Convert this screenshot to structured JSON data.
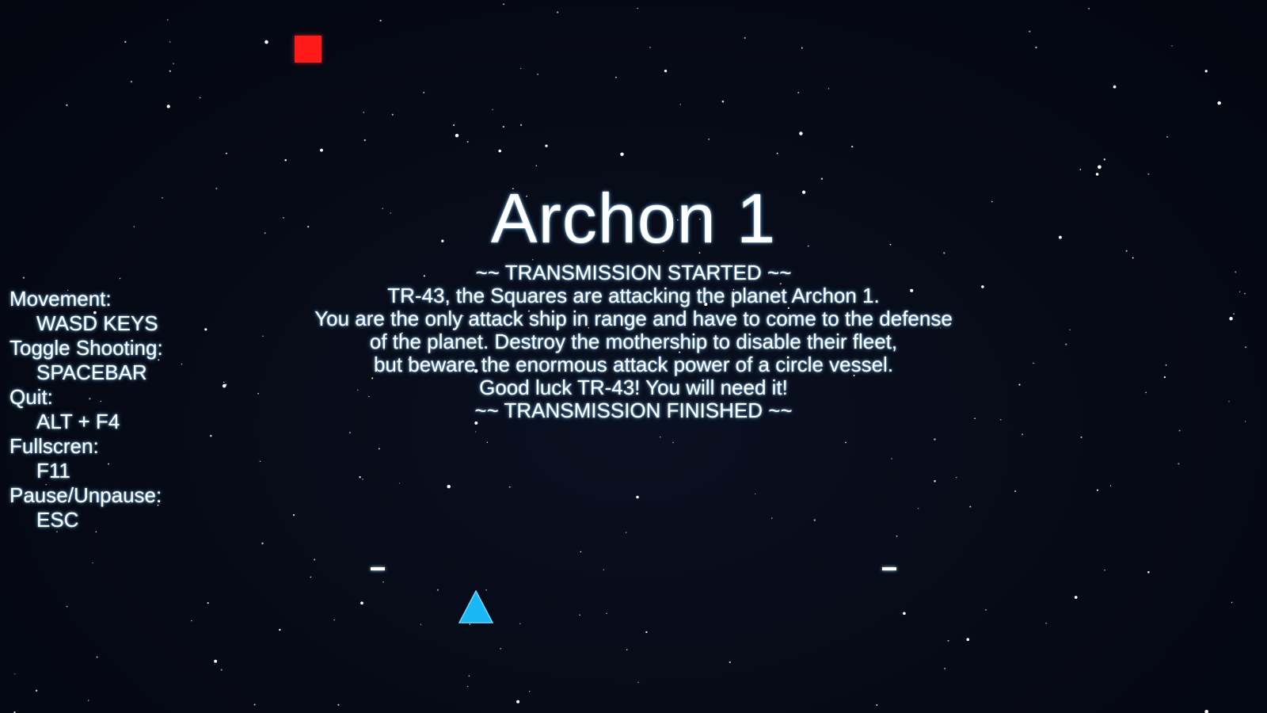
{
  "game": {
    "title": "Archon 1",
    "transmission": {
      "start": "~~ TRANSMISSION STARTED ~~",
      "lines": [
        "TR-43, the Squares are attacking the planet Archon 1.",
        "You are the only attack ship in range and have to come to the defense",
        "of the planet. Destroy the mothership to disable their fleet,",
        "but beware the enormous attack power of a circle vessel.",
        "Good luck TR-43! You will need it!"
      ],
      "end": "~~ TRANSMISSION FINISHED ~~"
    },
    "controls": [
      {
        "action": "Movement:",
        "key": "WASD KEYS"
      },
      {
        "action": "Toggle Shooting:",
        "key": "SPACEBAR"
      },
      {
        "action": "Quit:",
        "key": "ALT + F4"
      },
      {
        "action": "Fullscren:",
        "key": "F11"
      },
      {
        "action": "Pause/Unpause:",
        "key": "ESC"
      }
    ],
    "colors": {
      "background": "#050914",
      "enemy_square": "#ff1a1a",
      "player_ship": "#19b8f5",
      "text": "#ffffff",
      "star": "#ffffff"
    },
    "icons": {
      "enemy": "red-square-icon",
      "player": "cyan-triangle-ship-icon",
      "projectile": "white-dash-bullet-icon"
    }
  }
}
